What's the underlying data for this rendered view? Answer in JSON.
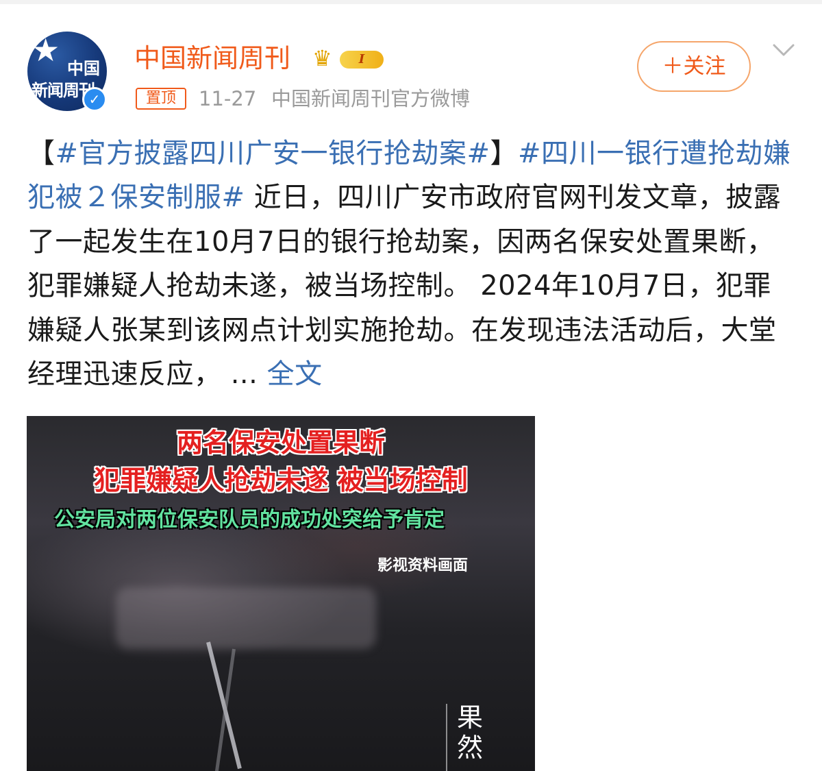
{
  "header": {
    "avatar_text_line1": "中国",
    "avatar_text_line2": "新闻周刊",
    "username": "中国新闻周刊",
    "level_badge": "I",
    "pin_label": "置顶",
    "date": "11-27",
    "source": "中国新闻周刊官方微博",
    "follow_label": "＋关注"
  },
  "post": {
    "open_bracket": "【",
    "hashtag1": "#官方披露四川广安一银行抢劫案#",
    "close_bracket": "】",
    "hashtag2": "#四川一银行遭抢劫嫌犯被２保安制服#",
    "body": " 近日，四川广安市政府官网刊发文章，披露了一起发生在10月7日的银行抢劫案，因两名保安处置果断，犯罪嫌疑人抢劫未遂，被当场控制。 2024年10月7日，犯罪嫌疑人张某到该网点计划实施抢劫。在发现违法活动后，大堂经理迅速反应，  ... ",
    "full_text_link": "全文"
  },
  "media": {
    "caption_line1": "两名保安处置果断",
    "caption_line2": "犯罪嫌疑人抢劫未遂 被当场控制",
    "caption_line3": "公安局对两位保安队员的成功处突给予肯定",
    "note": "影视资料画面",
    "side_text": "果然"
  },
  "colors": {
    "accent_orange": "#f05a1a",
    "link_blue": "#3a6fb3",
    "meta_gray": "#9a9a9a",
    "verified_blue": "#2a8cf0"
  },
  "icons": [
    "verified-icon",
    "crown-icon",
    "chevron-down-icon"
  ]
}
